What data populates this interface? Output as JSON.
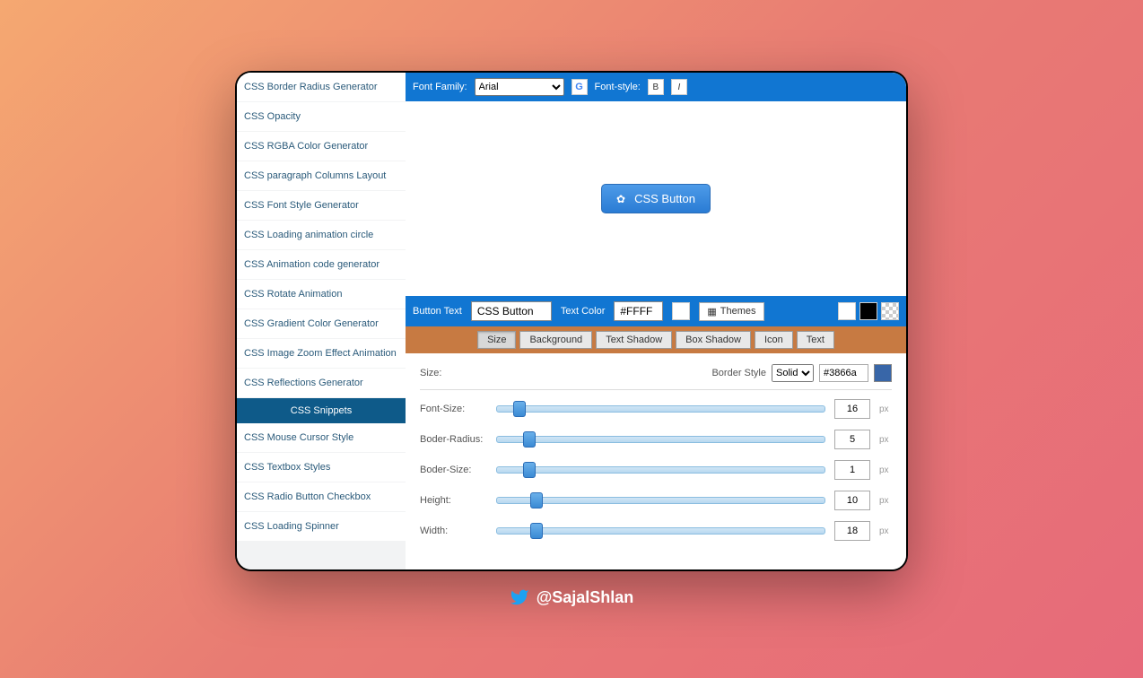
{
  "sidebar": {
    "items_top": [
      "CSS Border Radius Generator",
      "CSS Opacity",
      "CSS RGBA Color Generator",
      "CSS paragraph Columns Layout",
      "CSS Font Style Generator",
      "CSS Loading animation circle",
      "CSS Animation code generator",
      "CSS Rotate Animation",
      "CSS Gradient Color Generator",
      "CSS Image Zoom Effect Animation",
      "CSS Reflections Generator"
    ],
    "header": "CSS Snippets",
    "items_bottom": [
      "CSS Mouse Cursor Style",
      "CSS Textbox Styles",
      "CSS Radio Button Checkbox",
      "CSS Loading Spinner"
    ]
  },
  "toolbar": {
    "font_family_label": "Font Family:",
    "font_family_value": "Arial",
    "font_style_label": "Font-style:",
    "bold": "B",
    "italic": "I"
  },
  "preview": {
    "button_label": "CSS Button"
  },
  "midbar": {
    "button_text_label": "Button Text",
    "button_text_value": "CSS Button",
    "text_color_label": "Text Color",
    "text_color_value": "#FFFF",
    "themes_label": "Themes"
  },
  "tabs": [
    "Size",
    "Background",
    "Text Shadow",
    "Box Shadow",
    "Icon",
    "Text"
  ],
  "panel": {
    "title": "Size:",
    "border_style_label": "Border Style",
    "border_style_value": "Solid",
    "border_color_value": "#3866a",
    "sliders": [
      {
        "label": "Font-Size:",
        "value": "16",
        "pos": 5
      },
      {
        "label": "Boder-Radius:",
        "value": "5",
        "pos": 8
      },
      {
        "label": "Boder-Size:",
        "value": "1",
        "pos": 8
      },
      {
        "label": "Height:",
        "value": "10",
        "pos": 10
      },
      {
        "label": "Width:",
        "value": "18",
        "pos": 10
      }
    ],
    "unit": "px"
  },
  "attribution": "@SajalShlan"
}
